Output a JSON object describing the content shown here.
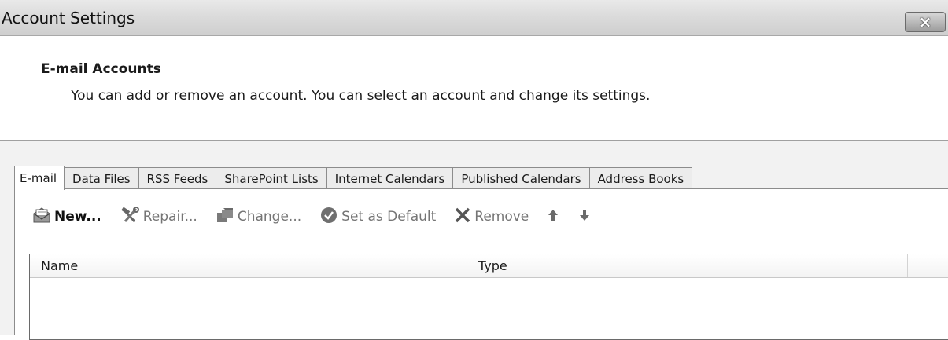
{
  "window": {
    "title": "Account Settings",
    "close_glyph": "×"
  },
  "header": {
    "section_title": "E-mail Accounts",
    "description": "You can add or remove an account. You can select an account and change its settings."
  },
  "tabs": [
    {
      "label": "E-mail",
      "active": true
    },
    {
      "label": "Data Files"
    },
    {
      "label": "RSS Feeds"
    },
    {
      "label": "SharePoint Lists"
    },
    {
      "label": "Internet Calendars"
    },
    {
      "label": "Published Calendars"
    },
    {
      "label": "Address Books"
    }
  ],
  "toolbar": {
    "new_label": "New...",
    "repair_label": "Repair...",
    "change_label": "Change...",
    "set_default_label": "Set as Default",
    "remove_label": "Remove",
    "icons": [
      "new-mail-icon",
      "repair-tools-icon",
      "change-icon",
      "check-circle-icon",
      "remove-x-icon",
      "arrow-up-icon",
      "arrow-down-icon"
    ]
  },
  "list": {
    "columns": [
      "Name",
      "Type"
    ]
  }
}
